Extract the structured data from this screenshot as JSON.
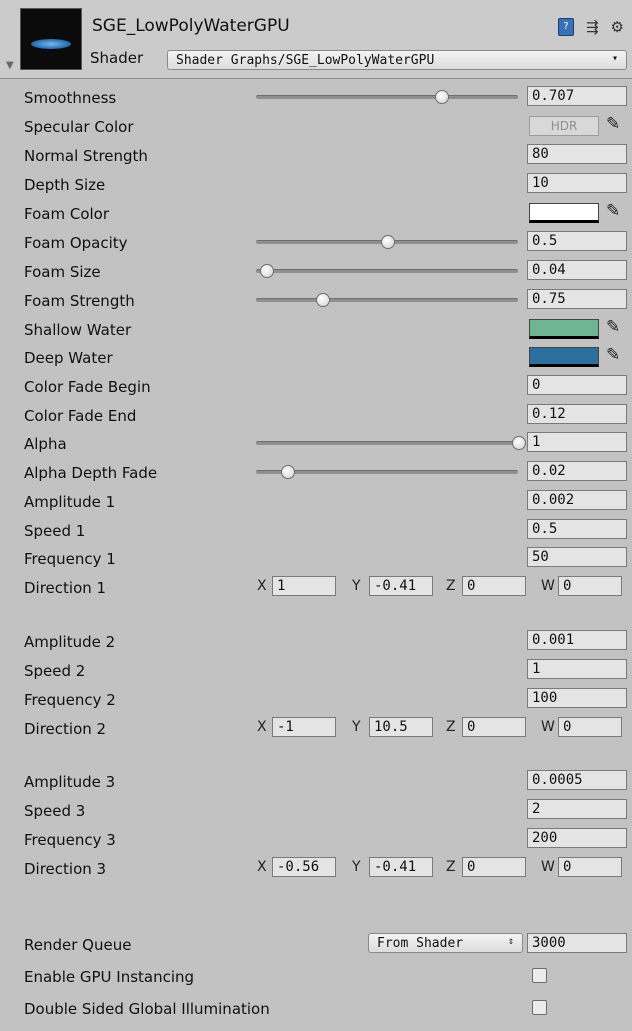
{
  "header": {
    "material_name": "SGE_LowPolyWaterGPU",
    "shader_label": "Shader",
    "shader_value": "Shader Graphs/SGE_LowPolyWaterGPU",
    "icons": [
      "book-icon",
      "preset-icon",
      "gear-icon"
    ]
  },
  "props": {
    "smoothness": {
      "label": "Smoothness",
      "value": "0.707",
      "slider": 0.707
    },
    "specular": {
      "label": "Specular Color",
      "hdr": "HDR"
    },
    "normal_strength": {
      "label": "Normal Strength",
      "value": "80"
    },
    "depth_size": {
      "label": "Depth Size",
      "value": "10"
    },
    "foam_color": {
      "label": "Foam Color",
      "color": "#ffffff"
    },
    "foam_opacity": {
      "label": "Foam Opacity",
      "value": "0.5",
      "slider": 0.5
    },
    "foam_size": {
      "label": "Foam Size",
      "value": "0.04",
      "slider": 0.04
    },
    "foam_strength": {
      "label": "Foam Strength",
      "value": "0.75",
      "slider": 0.25
    },
    "shallow_water": {
      "label": "Shallow Water",
      "color": "#6fb594"
    },
    "deep_water": {
      "label": "Deep Water",
      "color": "#2e6e9e"
    },
    "color_fade_begin": {
      "label": "Color Fade Begin",
      "value": "0"
    },
    "color_fade_end": {
      "label": "Color Fade End",
      "value": "0.12"
    },
    "alpha": {
      "label": "Alpha",
      "value": "1",
      "slider": 1.0
    },
    "alpha_depth_fade": {
      "label": "Alpha Depth Fade",
      "value": "0.02",
      "slider": 0.12
    },
    "amplitude1": {
      "label": "Amplitude 1",
      "value": "0.002"
    },
    "speed1": {
      "label": "Speed 1",
      "value": "0.5"
    },
    "frequency1": {
      "label": "Frequency 1",
      "value": "50"
    },
    "direction1": {
      "label": "Direction 1",
      "x": "1",
      "y": "-0.41",
      "z": "0",
      "w": "0"
    },
    "amplitude2": {
      "label": "Amplitude 2",
      "value": "0.001"
    },
    "speed2": {
      "label": "Speed 2",
      "value": "1"
    },
    "frequency2": {
      "label": "Frequency 2",
      "value": "100"
    },
    "direction2": {
      "label": "Direction 2",
      "x": "-1",
      "y": "10.5",
      "z": "0",
      "w": "0"
    },
    "amplitude3": {
      "label": "Amplitude 3",
      "value": "0.0005"
    },
    "speed3": {
      "label": "Speed 3",
      "value": "2"
    },
    "frequency3": {
      "label": "Frequency 3",
      "value": "200"
    },
    "direction3": {
      "label": "Direction 3",
      "x": "-0.56",
      "y": "-0.41",
      "z": "0",
      "w": "0"
    }
  },
  "vector_labels": {
    "x": "X",
    "y": "Y",
    "z": "Z",
    "w": "W"
  },
  "footer": {
    "render_queue_label": "Render Queue",
    "render_queue_mode": "From Shader",
    "render_queue_value": "3000",
    "gpu_instancing_label": "Enable GPU Instancing",
    "gpu_instancing_checked": false,
    "double_sided_gi_label": "Double Sided Global Illumination",
    "double_sided_gi_checked": false
  }
}
